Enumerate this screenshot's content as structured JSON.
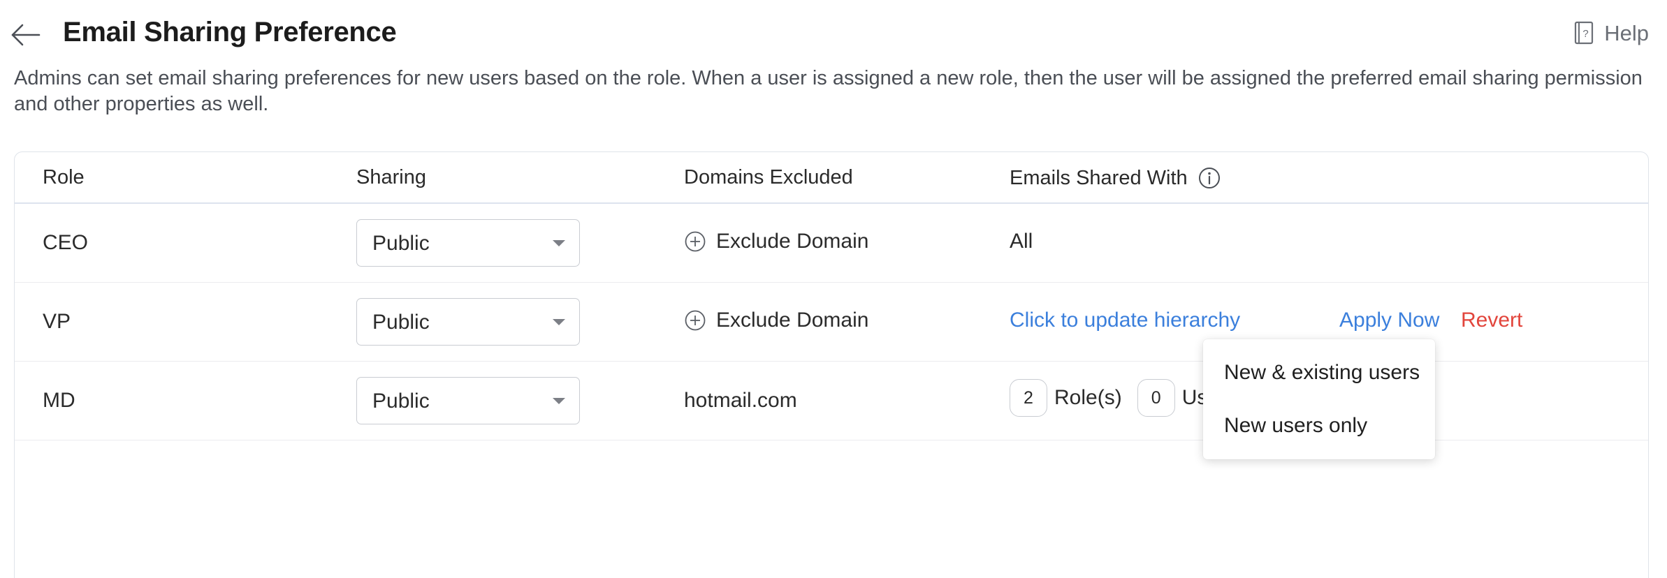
{
  "header": {
    "title": "Email Sharing Preference",
    "help_label": "Help",
    "description": "Admins can set email sharing preferences for new users based on the role. When a user is assigned a new role, then the user will be assigned the preferred email sharing permission and other properties as well."
  },
  "table": {
    "columns": [
      "Role",
      "Sharing",
      "Domains Excluded",
      "Emails Shared With"
    ],
    "rows": [
      {
        "role": "CEO",
        "sharing": "Public",
        "domains_excluded": "Exclude Domain",
        "emails_shared_with": "All"
      },
      {
        "role": "VP",
        "sharing": "Public",
        "domains_excluded": "Exclude Domain",
        "emails_shared_with": "Click to update hierarchy",
        "apply_label": "Apply Now",
        "revert_label": "Revert"
      },
      {
        "role": "MD",
        "sharing": "Public",
        "domains_excluded": "hotmail.com",
        "roles_count": "2",
        "roles_label": "Role(s)",
        "users_count": "0",
        "users_label": "Us"
      }
    ]
  },
  "apply_menu": {
    "items": [
      "New & existing users",
      "New users only"
    ]
  },
  "colors": {
    "link": "#3b7fdc",
    "danger": "#e2453c",
    "border": "#dfe3ea"
  },
  "icons": [
    "back-arrow-icon",
    "help-book-icon",
    "info-icon",
    "plus-circle-icon",
    "dropdown-caret-icon"
  ]
}
